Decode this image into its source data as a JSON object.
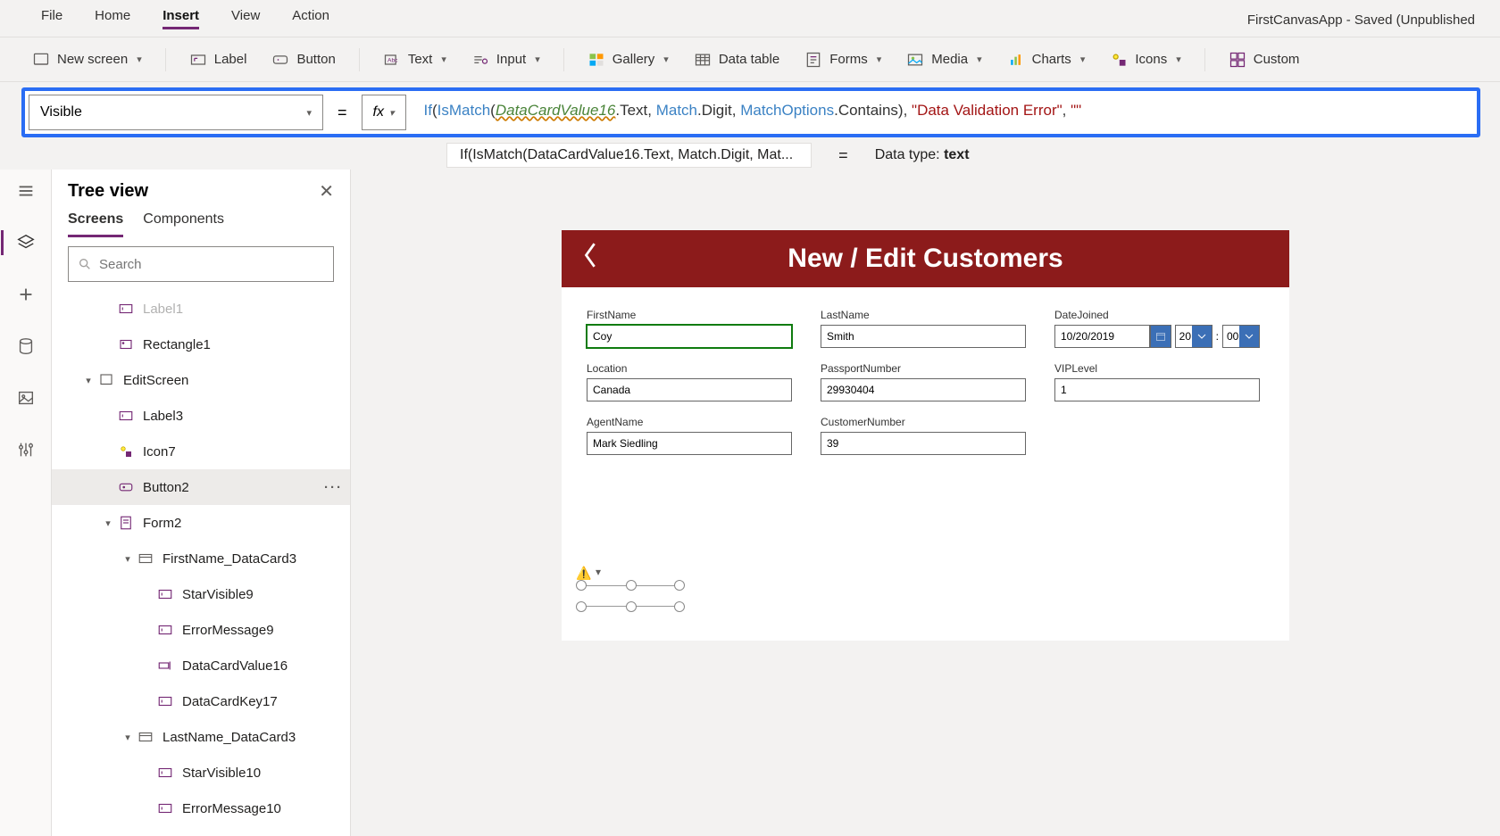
{
  "menubar": {
    "items": [
      "File",
      "Home",
      "Insert",
      "View",
      "Action"
    ],
    "active_index": 2,
    "app_title": "FirstCanvasApp - Saved (Unpublished"
  },
  "ribbon": {
    "new_screen": "New screen",
    "label": "Label",
    "button": "Button",
    "text": "Text",
    "input": "Input",
    "gallery": "Gallery",
    "data_table": "Data table",
    "forms": "Forms",
    "media": "Media",
    "charts": "Charts",
    "icons": "Icons",
    "custom": "Custom"
  },
  "formula": {
    "property": "Visible",
    "fx": "fx",
    "tokens": {
      "if": "If",
      "lpar": "(",
      "ismatch": "IsMatch",
      "lpar2": "(",
      "dcv": "DataCardValue16",
      "dot_text": ".Text, ",
      "match": "Match",
      "dot_digit": ".Digit, ",
      "mopts": "MatchOptions",
      "dot_contains": ".Contains",
      "rpar": "), ",
      "str1": "\"Data Validation Error\"",
      "comma": ", ",
      "str2": "\"\""
    },
    "readout_formula": "If(IsMatch(DataCardValue16.Text, Match.Digit, Mat...",
    "readout_eq": "=",
    "readout_datatype_label": "Data type: ",
    "readout_datatype_value": "text"
  },
  "tree": {
    "title": "Tree view",
    "tabs": {
      "screens": "Screens",
      "components": "Components"
    },
    "search_placeholder": "Search",
    "nodes": [
      {
        "indent": 2,
        "icon": "label",
        "label": "Label1",
        "caret": "",
        "dim": true
      },
      {
        "indent": 2,
        "icon": "rect",
        "label": "Rectangle1",
        "caret": ""
      },
      {
        "indent": 1,
        "icon": "screen",
        "label": "EditScreen",
        "caret": "v"
      },
      {
        "indent": 2,
        "icon": "label",
        "label": "Label3",
        "caret": ""
      },
      {
        "indent": 2,
        "icon": "icon",
        "label": "Icon7",
        "caret": ""
      },
      {
        "indent": 2,
        "icon": "button",
        "label": "Button2",
        "caret": "",
        "selected": true
      },
      {
        "indent": 2,
        "icon": "form",
        "label": "Form2",
        "caret": "v"
      },
      {
        "indent": 3,
        "icon": "card",
        "label": "FirstName_DataCard3",
        "caret": "v"
      },
      {
        "indent": 4,
        "icon": "label",
        "label": "StarVisible9",
        "caret": ""
      },
      {
        "indent": 4,
        "icon": "label",
        "label": "ErrorMessage9",
        "caret": ""
      },
      {
        "indent": 4,
        "icon": "input",
        "label": "DataCardValue16",
        "caret": ""
      },
      {
        "indent": 4,
        "icon": "label",
        "label": "DataCardKey17",
        "caret": ""
      },
      {
        "indent": 3,
        "icon": "card",
        "label": "LastName_DataCard3",
        "caret": "v"
      },
      {
        "indent": 4,
        "icon": "label",
        "label": "StarVisible10",
        "caret": ""
      },
      {
        "indent": 4,
        "icon": "label",
        "label": "ErrorMessage10",
        "caret": ""
      }
    ]
  },
  "rail": {
    "items": [
      "hamburger",
      "tree",
      "insert",
      "data",
      "media",
      "advanced"
    ]
  },
  "app": {
    "header": "New / Edit Customers",
    "fields": {
      "firstname": {
        "label": "FirstName",
        "value": "Coy"
      },
      "lastname": {
        "label": "LastName",
        "value": "Smith"
      },
      "datejoined": {
        "label": "DateJoined",
        "value": "10/20/2019",
        "hh": "20",
        "mm": "00"
      },
      "location": {
        "label": "Location",
        "value": "Canada"
      },
      "passport": {
        "label": "PassportNumber",
        "value": "29930404"
      },
      "vip": {
        "label": "VIPLevel",
        "value": "1"
      },
      "agent": {
        "label": "AgentName",
        "value": "Mark Siedling"
      },
      "custno": {
        "label": "CustomerNumber",
        "value": "39"
      }
    }
  }
}
